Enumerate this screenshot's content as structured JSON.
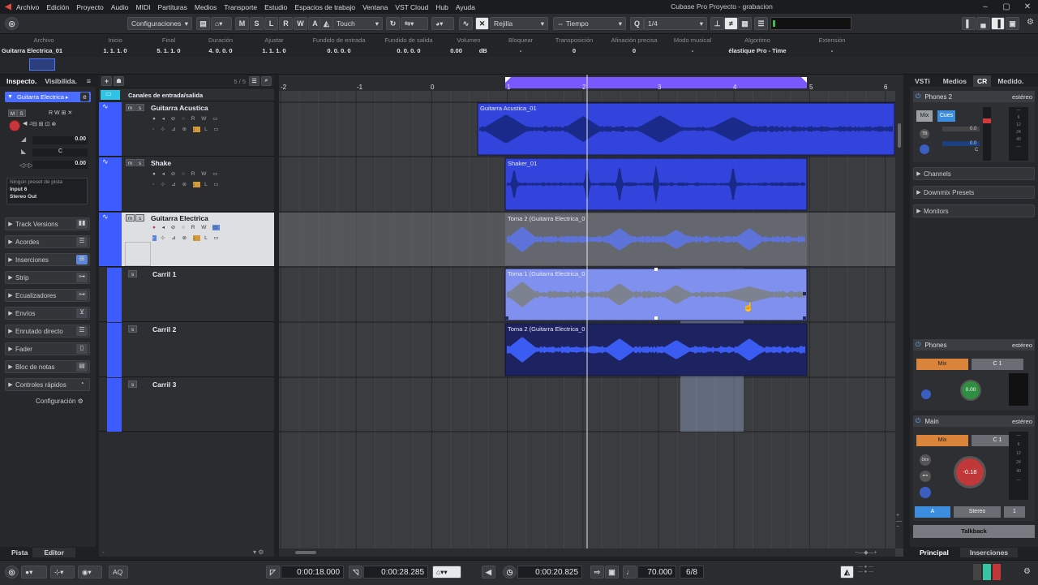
{
  "app": {
    "title": "Cubase Pro Proyecto - grabacion",
    "menu": [
      "Archivo",
      "Edición",
      "Proyecto",
      "Audio",
      "MIDI",
      "Partituras",
      "Medios",
      "Transporte",
      "Estudio",
      "Espacios de trabajo",
      "Ventana",
      "VST Cloud",
      "Hub",
      "Ayuda"
    ]
  },
  "toolbar": {
    "config_label": "Configuraciones",
    "mode_buttons": [
      "M",
      "S",
      "L",
      "R",
      "W",
      "A"
    ],
    "touch_label": "Touch",
    "snap_label": "Rejilla",
    "grid_type": "Tiempo",
    "quantize": "1/4"
  },
  "infoline": {
    "headers": [
      "Archivo",
      "Inicio",
      "Final",
      "Duración",
      "Ajustar",
      "Fundido de entrada",
      "Fundido de salida",
      "Volumen",
      "Bloquear",
      "Transposición",
      "Afinación precisa",
      "Modo musical",
      "Algoritmo",
      "Extensión"
    ],
    "values": [
      "Guitarra Electrica_01",
      "1. 1. 1.   0",
      "5. 1. 1.   0",
      "4. 0. 0.   0",
      "1. 1. 1.   0",
      "0. 0. 0.   0",
      "0. 0. 0.   0",
      "0.00",
      "-",
      "0",
      "0",
      "-",
      "élastique Pro - Time",
      "-"
    ],
    "volume_unit": "dB"
  },
  "inspector": {
    "tabs": [
      "Inspecto.",
      "Visibilida."
    ],
    "track_name": "Guitarra Electrica",
    "vol_value": "0.00",
    "pan_value": "C",
    "delay_value": "0.00",
    "preset": "Ningún preset de pista",
    "input": "Input 6",
    "output": "Stereo Out",
    "sections": [
      "Track Versions",
      "Acordes",
      "Inserciones",
      "Strip",
      "Ecualizadores",
      "Envíos",
      "Enrutado directo",
      "Fader",
      "Bloc de notas",
      "Controles rápidos"
    ],
    "config_label": "Configuración",
    "bottom_tabs": [
      "Pista",
      "Editor"
    ]
  },
  "tracklist": {
    "count": "5 / 5",
    "folder_name": "Canales de entrada/salida",
    "tracks": [
      {
        "name": "Guitarra Acustica"
      },
      {
        "name": "Shake"
      },
      {
        "name": "Guitarra Electrica"
      }
    ],
    "lanes": [
      "Carril 1",
      "Carril 2",
      "Carril 3"
    ]
  },
  "ruler": {
    "labels": [
      "-2",
      "-1",
      "0",
      "1",
      "2",
      "3",
      "4",
      "5",
      "6"
    ]
  },
  "events": [
    {
      "name": "Guitarra Acustica_01"
    },
    {
      "name": "Shaker_01"
    },
    {
      "name": "Toma 2 (Guitarra Electrica_0"
    },
    {
      "name": "Toma 1 (Guitarra Electrica_0"
    },
    {
      "name": "Toma 2 (Guitarra Electrica_0"
    }
  ],
  "rightzone": {
    "tabs": [
      "VSTi",
      "Medios",
      "CR",
      "Medido."
    ],
    "phones2": {
      "title": "Phones 2",
      "format": "estéreo",
      "mix": "Mix",
      "cues": "Cues",
      "val1": "0.0",
      "val2": "0.0",
      "val3": "C"
    },
    "folds": [
      "Channels",
      "Downmix Presets",
      "Monitors"
    ],
    "phones": {
      "title": "Phones",
      "format": "estéreo",
      "mix": "Mix",
      "ch": "C 1",
      "knob": "0.00"
    },
    "main": {
      "title": "Main",
      "format": "estéreo",
      "mix": "Mix",
      "ch": "C 1",
      "knob": "-0.18",
      "dim": "Dim",
      "a": "A",
      "stereo": "Stereo",
      "one": "1"
    },
    "talkback": "Talkback",
    "bottom_tabs": [
      "Principal",
      "Inserciones"
    ]
  },
  "transport": {
    "left_locator": "0:00:18.000",
    "right_locator": "0:00:28.285",
    "position": "0:00:20.825",
    "tempo": "70.000",
    "signature": "6/8",
    "aq": "AQ"
  },
  "colors": {
    "accent": "#3c5cff",
    "track_select": "#5a7cff",
    "purple_range": "#7a58ff"
  }
}
